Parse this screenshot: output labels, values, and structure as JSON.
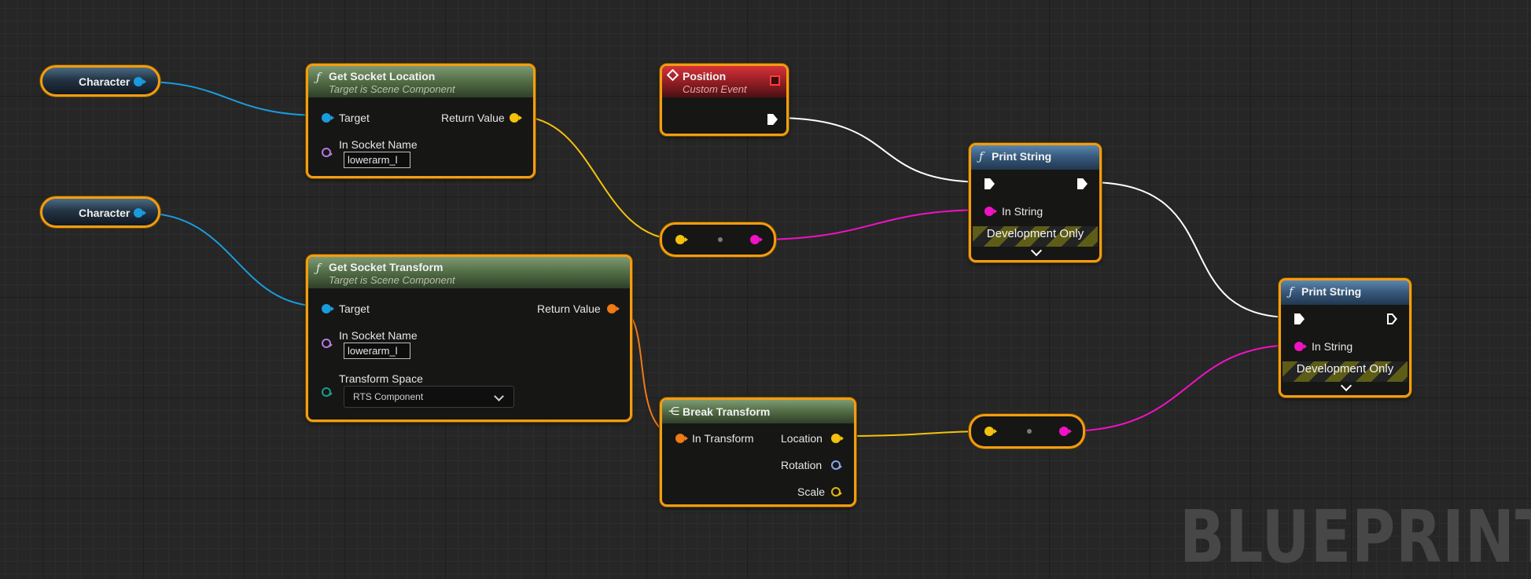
{
  "graph": {
    "watermark": "BLUEPRINT",
    "colors": {
      "object_pin": "#1a9bdc",
      "vector_pin": "#f4c20d",
      "transform_pin": "#f07a14",
      "string_pin": "#f012c4",
      "selection_outline": "#f39c12"
    },
    "nodes": {
      "character1": {
        "label": "Character"
      },
      "character2": {
        "label": "Character"
      },
      "get_socket_location": {
        "title": "Get Socket Location",
        "subtitle": "Target is Scene Component",
        "target_label": "Target",
        "return_label": "Return Value",
        "socket_name_label": "In Socket Name",
        "socket_name_value": "lowerarm_l"
      },
      "get_socket_transform": {
        "title": "Get Socket Transform",
        "subtitle": "Target is Scene Component",
        "target_label": "Target",
        "return_label": "Return Value",
        "socket_name_label": "In Socket Name",
        "socket_name_value": "lowerarm_l",
        "transform_space_label": "Transform Space",
        "transform_space_value": "RTS Component"
      },
      "position_event": {
        "title": "Position",
        "subtitle": "Custom Event"
      },
      "break_transform": {
        "title": "Break Transform",
        "in_label": "In Transform",
        "location_label": "Location",
        "rotation_label": "Rotation",
        "scale_label": "Scale"
      },
      "print_string1": {
        "title": "Print String",
        "in_string_label": "In String",
        "dev_only": "Development Only"
      },
      "print_string2": {
        "title": "Print String",
        "in_string_label": "In String",
        "dev_only": "Development Only"
      }
    }
  }
}
